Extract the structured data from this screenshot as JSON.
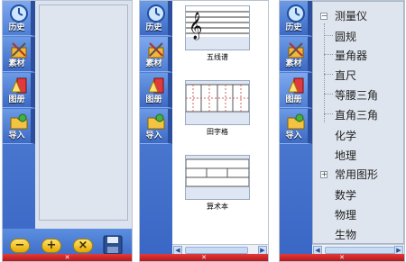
{
  "sidebar": {
    "items": [
      {
        "label": "历史",
        "icon": "clock-icon"
      },
      {
        "label": "素材",
        "icon": "tools-icon"
      },
      {
        "label": "图册",
        "icon": "shapes-icon"
      },
      {
        "label": "导入",
        "icon": "folder-import-icon"
      }
    ]
  },
  "panel1": {
    "toolbar": [
      {
        "label": "−",
        "icon": "minus-icon"
      },
      {
        "label": "+",
        "icon": "plus-icon"
      },
      {
        "label": "×",
        "icon": "close-icon"
      },
      {
        "label": "",
        "icon": "save-icon"
      }
    ]
  },
  "panel2": {
    "templates": [
      {
        "label": "五线谱",
        "icon": "staff-icon"
      },
      {
        "label": "田字格",
        "icon": "tian-grid-icon"
      },
      {
        "label": "算术本",
        "icon": "arithmetic-book-icon"
      }
    ]
  },
  "panel3": {
    "tree": [
      {
        "label": "测量仪",
        "expanded": true,
        "children": [
          "圆规",
          "量角器",
          "直尺",
          "等腰三角",
          "直角三角"
        ]
      },
      {
        "label": "化学"
      },
      {
        "label": "地理"
      },
      {
        "label": "常用图形",
        "expanded": false
      },
      {
        "label": "数学"
      },
      {
        "label": "物理"
      },
      {
        "label": "生物"
      }
    ],
    "expand_collapsed": "+",
    "expand_open": "−"
  },
  "bottom_marker": "✕"
}
